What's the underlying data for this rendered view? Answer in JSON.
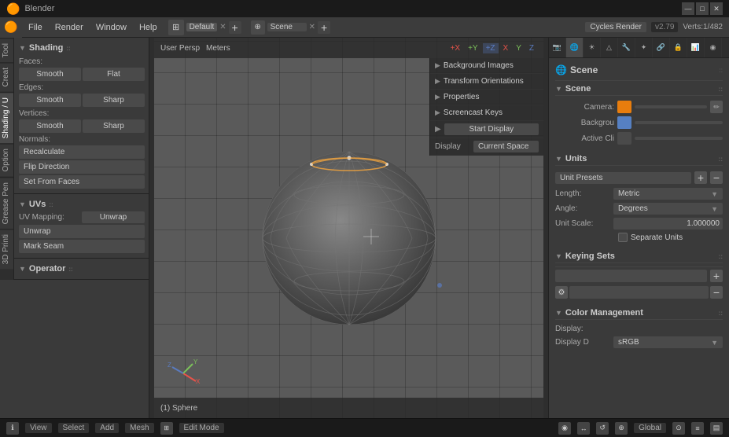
{
  "app": {
    "title": "Blender",
    "logo": "🟠",
    "version": "v2.79",
    "verts": "Verts:1/482"
  },
  "titlebar": {
    "title": "Blender",
    "minimize": "—",
    "maximize": "□",
    "close": "✕"
  },
  "menubar": {
    "items": [
      "File",
      "Render",
      "Window",
      "Help"
    ]
  },
  "workspaces": {
    "tabs": [
      {
        "label": "Default",
        "active": true
      },
      {
        "label": "Scene",
        "active": false
      }
    ],
    "add": "+"
  },
  "render_engine": {
    "label": "Cycles Render",
    "version": "v2.79",
    "verts": "Verts:1/482"
  },
  "side_tabs": [
    {
      "label": "Tool",
      "active": false
    },
    {
      "label": "Creat",
      "active": false
    },
    {
      "label": "Shading / U",
      "active": true
    },
    {
      "label": "Option",
      "active": false
    },
    {
      "label": "Grease Pen",
      "active": false
    },
    {
      "label": "3D Printi",
      "active": false
    }
  ],
  "shading_panel": {
    "title": "Shading",
    "faces": {
      "label": "Faces:",
      "smooth": "Smooth",
      "flat": "Flat"
    },
    "edges": {
      "label": "Edges:",
      "smooth": "Smooth",
      "sharp": "Sharp"
    },
    "vertices": {
      "label": "Vertices:",
      "smooth": "Smooth",
      "sharp": "Sharp"
    },
    "normals": {
      "label": "Normals:",
      "recalculate": "Recalculate",
      "flip_direction": "Flip Direction",
      "set_from_faces": "Set From Faces"
    }
  },
  "uvs_panel": {
    "title": "UVs",
    "uv_mapping": {
      "label": "UV Mapping:",
      "value": "Unwrap"
    },
    "unwrap": "Unwrap",
    "mark_seam": "Mark Seam"
  },
  "operator_panel": {
    "title": "Operator"
  },
  "viewport": {
    "view": "User Persp",
    "units": "Meters",
    "object_name": "(1) Sphere",
    "mode": "Edit Mode",
    "global": "Global"
  },
  "overlay": {
    "items": [
      {
        "label": "Background Images",
        "arrow": "▶"
      },
      {
        "label": "Transform Orientations",
        "arrow": "▶"
      },
      {
        "label": "Properties",
        "arrow": "▶"
      },
      {
        "label": "Screencast Keys",
        "arrow": "▶"
      }
    ],
    "start_display": "Start Display",
    "display_label": "Display",
    "current_space": "Current Space"
  },
  "axis_bar": {
    "x": "+X",
    "y": "+Y",
    "z": "+Z",
    "xn": "X",
    "yn": "Y",
    "zn": "Z"
  },
  "right_panel": {
    "icon_tabs": [
      "↑",
      "🎬",
      "☀",
      "🌐",
      "△",
      "📷",
      "🔗",
      "🔧",
      "🔒",
      "👤",
      "📊"
    ],
    "scene_section": {
      "title": "Scene",
      "camera": {
        "label": "Camera:",
        "value": ""
      },
      "background": {
        "label": "Backgrou",
        "value": ""
      },
      "active_clip": {
        "label": "Active Cli",
        "value": ""
      }
    },
    "units_section": {
      "title": "Units",
      "presets_label": "Unit Presets",
      "length_label": "Length:",
      "length_value": "Metric",
      "angle_label": "Angle:",
      "angle_value": "Degrees",
      "unit_scale_label": "Unit Scale:",
      "unit_scale_value": "1.000000",
      "separate_units_label": "Separate Units"
    },
    "keying_section": {
      "title": "Keying Sets"
    },
    "color_section": {
      "title": "Color Management",
      "display_label": "Display:",
      "display_d_label": "Display D",
      "display_d_value": "sRGB"
    }
  },
  "statusbar": {
    "view": "View",
    "select": "Select",
    "add": "Add",
    "mesh": "Mesh",
    "mode": "Edit Mode",
    "global": "Global"
  }
}
